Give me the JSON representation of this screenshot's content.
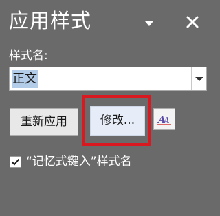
{
  "pane": {
    "title": "应用样式",
    "title_menu_icon": "triangle-down-icon",
    "close_icon": "close-icon"
  },
  "style_name": {
    "label": "样式名:",
    "value": "正文",
    "dropdown_icon": "chevron-down-icon"
  },
  "buttons": {
    "reapply_label": "重新应用",
    "modify_label": "修改...",
    "styles_icon": "styles-aa-icon"
  },
  "autocomplete": {
    "label": "“记忆式键入”样式名",
    "checked": true
  },
  "colors": {
    "background": "#6a6a6a",
    "highlight_border": "#d9181f",
    "selection": "#b3cde9"
  }
}
